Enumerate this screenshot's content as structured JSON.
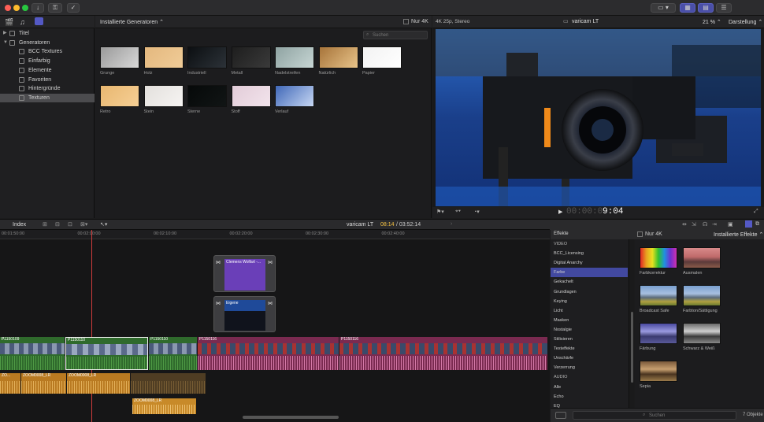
{
  "toolbar": {
    "icons": [
      "import-icon",
      "key-icon",
      "check-icon",
      "speech-icon",
      "grid-icon",
      "filmstrip-icon",
      "sliders-icon"
    ]
  },
  "sidebar": {
    "items": [
      {
        "label": "Titel",
        "level": 0,
        "expanded": false
      },
      {
        "label": "Generatoren",
        "level": 0,
        "expanded": true
      },
      {
        "label": "BCC Textures",
        "level": 1
      },
      {
        "label": "Einfarbig",
        "level": 1
      },
      {
        "label": "Elemente",
        "level": 1
      },
      {
        "label": "Favoriten",
        "level": 1
      },
      {
        "label": "Hintergründe",
        "level": 1
      },
      {
        "label": "Texturen",
        "level": 1,
        "selected": true
      }
    ]
  },
  "browser": {
    "filter_label": "Installierte Generatoren",
    "only4k_label": "Nur 4K",
    "search_placeholder": "Suchen",
    "thumbs": [
      {
        "label": "Grunge",
        "color1": "#9a9a9a",
        "color2": "#d8d8d8"
      },
      {
        "label": "Holz",
        "color1": "#e4b87e",
        "color2": "#f0cc98"
      },
      {
        "label": "Industriell",
        "color1": "#0c0f12",
        "color2": "#2c3238"
      },
      {
        "label": "Metall",
        "color1": "#1e1e1e",
        "color2": "#3a3a3a"
      },
      {
        "label": "Nadelstreifen",
        "color1": "#8fa3a2",
        "color2": "#c7d6d4"
      },
      {
        "label": "Natürlich",
        "color1": "#a7743a",
        "color2": "#e8c48a"
      },
      {
        "label": "Papier",
        "color1": "#f2f2f2",
        "color2": "#ffffff"
      },
      {
        "label": "Retro",
        "color1": "#e8b770",
        "color2": "#f6cf95"
      },
      {
        "label": "Stein",
        "color1": "#e3e0dd",
        "color2": "#f6f4f2"
      },
      {
        "label": "Sterne",
        "color1": "#060909",
        "color2": "#111515"
      },
      {
        "label": "Stoff",
        "color1": "#e2ccd8",
        "color2": "#f2e4ec"
      },
      {
        "label": "Verlauf",
        "color1": "#4068b8",
        "color2": "#c7d7f3"
      }
    ]
  },
  "viewer": {
    "format": "4K 25p, Stereo",
    "project": "varicam LT",
    "zoom": "21 %",
    "display_label": "Darstellung",
    "timecode_dim": "00:00:0",
    "timecode_bright": "9:04"
  },
  "timeline": {
    "index_label": "Index",
    "project": "varicam LT",
    "position": "08:14",
    "duration": "/ 03:52:14",
    "ruler": [
      "00:01:50:00",
      "00:02:00:00",
      "00:02:10:00",
      "00:02:20:00",
      "00:02:30:00",
      "00:02:40:00"
    ],
    "connected_clips": [
      {
        "name": "Clemens Wolfart -...",
        "color": "#6a3fb8"
      },
      {
        "name": "Eigene",
        "color": "#10131c"
      }
    ],
    "video_clips": [
      "P...",
      "P1150109",
      "P1150110",
      "P1150110",
      "P1150116",
      "P1150116"
    ],
    "audio_clips": [
      "ZO...",
      "ZOOM0008_LR",
      "ZOOM0008_LR",
      "ZOOM0008_LR"
    ]
  },
  "effects": {
    "header_label": "Effekte",
    "only4k_label": "Nur 4K",
    "installed_label": "Installierte Effekte",
    "categories": [
      {
        "label": "VIDEO",
        "type": "hdr"
      },
      {
        "label": "BCC_Licensing"
      },
      {
        "label": "Digital Anarchy"
      },
      {
        "label": "Farbe",
        "selected": true
      },
      {
        "label": "Gekachelt"
      },
      {
        "label": "Grundlagen"
      },
      {
        "label": "Keying"
      },
      {
        "label": "Licht"
      },
      {
        "label": "Masken"
      },
      {
        "label": "Nostalgie"
      },
      {
        "label": "Stilisieren"
      },
      {
        "label": "Texteffekte"
      },
      {
        "label": "Unschärfe"
      },
      {
        "label": "Verzerrung"
      },
      {
        "label": "AUDIO",
        "type": "hdr"
      },
      {
        "label": "Alle"
      },
      {
        "label": "Echo"
      },
      {
        "label": "EQ"
      }
    ],
    "items": [
      {
        "label": "Farbkorrektur",
        "style": "spectrum"
      },
      {
        "label": "Ausmalen",
        "style": "dusk"
      },
      {
        "label": "Broadcast Safe",
        "style": "mountain"
      },
      {
        "label": "Farbton/Sättigung",
        "style": "mountain"
      },
      {
        "label": "Färbung",
        "style": "violet"
      },
      {
        "label": "Schwarz & Weiß",
        "style": "bw"
      },
      {
        "label": "Sepia",
        "style": "sepia"
      }
    ],
    "search_placeholder": "Suchen",
    "count": "7 Objekte"
  }
}
